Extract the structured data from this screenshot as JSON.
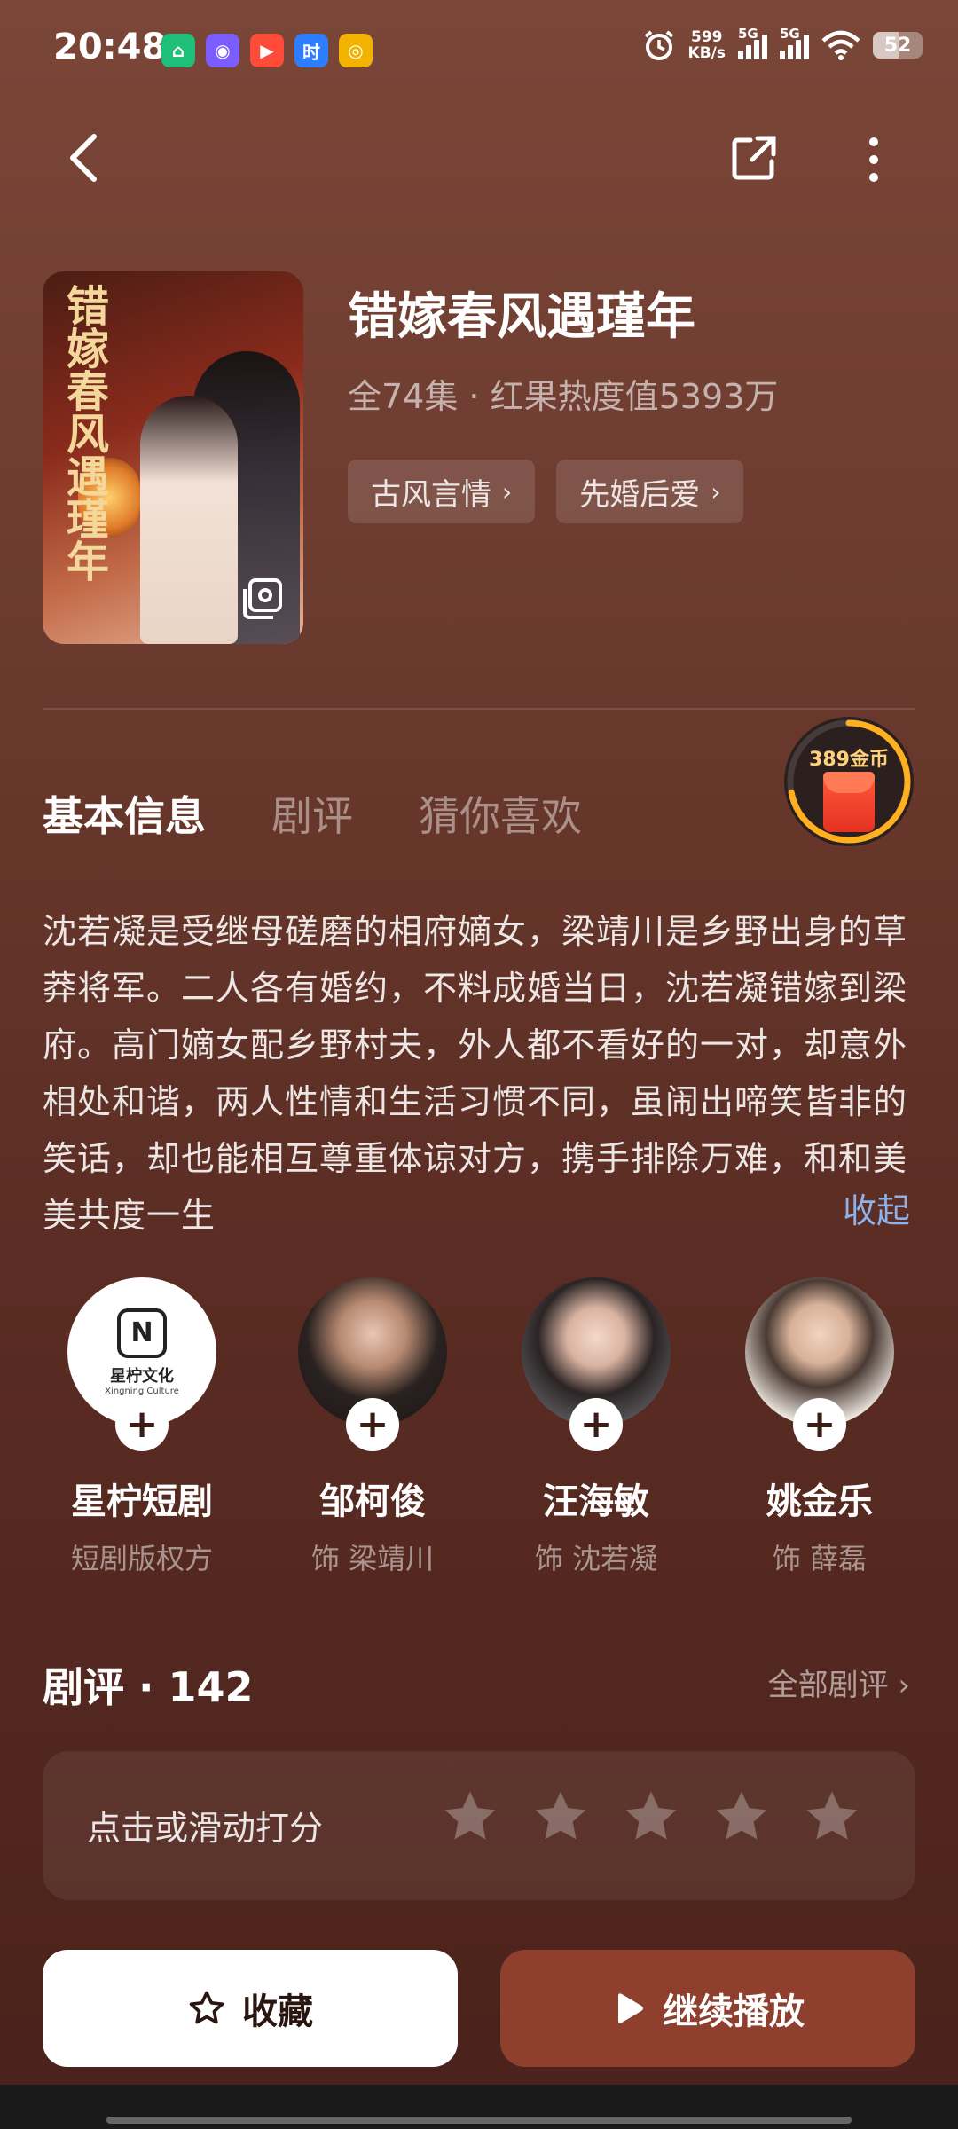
{
  "status_bar": {
    "time": "20:48",
    "net_speed_value": "599",
    "net_speed_unit": "KB/s",
    "sim1": "5G",
    "sim2": "5G",
    "battery": "52",
    "app_icons": [
      "home-app-icon",
      "browser-app-icon",
      "video-app-icon",
      "shi-app-icon",
      "weibo-app-icon"
    ],
    "shi_icon_text": "时"
  },
  "show": {
    "title": "错嫁春风遇瑾年",
    "meta": "全74集 · 红果热度值5393万",
    "cover_title": "错嫁春风遇瑾年",
    "tags": [
      {
        "label": "古风言情"
      },
      {
        "label": "先婚后爱"
      }
    ]
  },
  "coin_widget": {
    "label": "389金币",
    "progress": 0.72
  },
  "tabs": [
    {
      "label": "基本信息",
      "active": true
    },
    {
      "label": "剧评",
      "active": false
    },
    {
      "label": "猜你喜欢",
      "active": false
    }
  ],
  "description": "沈若凝是受继母磋磨的相府嫡女，梁靖川是乡野出身的草莽将军。二人各有婚约，不料成婚当日，沈若凝错嫁到梁府。高门嫡女配乡野村夫，外人都不看好的一对，却意外相处和谐，两人性情和生活习惯不同，虽闹出啼笑皆非的笑话，却也能相互尊重体谅对方，携手排除万难，和和美美共度一生",
  "collapse_label": "收起",
  "cast": [
    {
      "name": "星柠短剧",
      "role": "短剧版权方",
      "logo_text": "星柠文化",
      "logo_sub": "Xingning Culture",
      "logo_mark": "N"
    },
    {
      "name": "邹柯俊",
      "role": "饰 梁靖川"
    },
    {
      "name": "汪海敏",
      "role": "饰 沈若凝"
    },
    {
      "name": "姚金乐",
      "role": "饰 薛磊"
    }
  ],
  "follow_symbol": "+",
  "reviews": {
    "title": "剧评 · 142",
    "all_label": "全部剧评",
    "rating_prompt": "点击或滑动打分",
    "star_count": 5
  },
  "actions": {
    "favorite_label": "收藏",
    "play_label": "继续播放"
  },
  "colors": {
    "accent_link": "#8fb1e8",
    "play_button": "#8e3f2e",
    "coin_ring": "#ffb020"
  }
}
